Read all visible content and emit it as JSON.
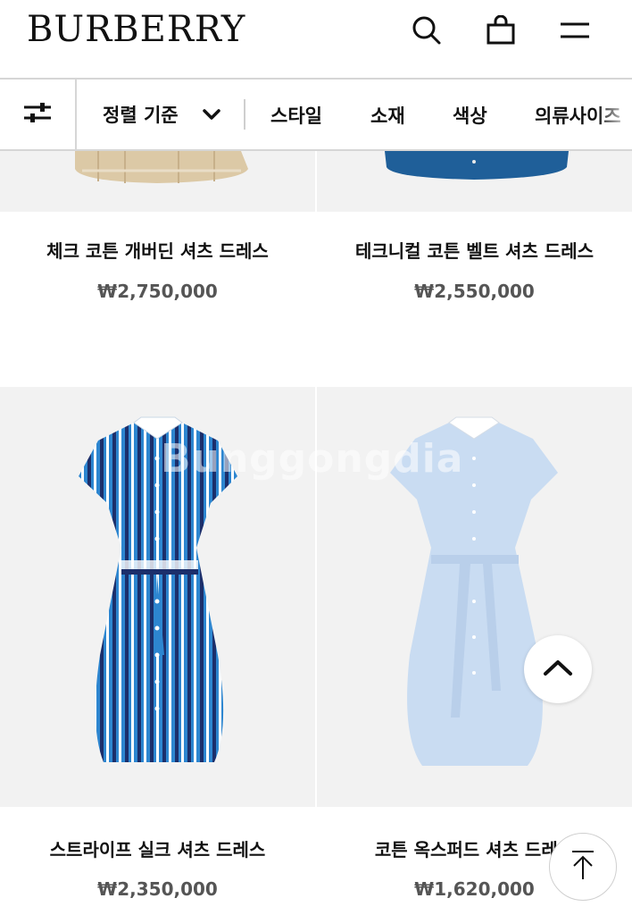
{
  "header": {
    "logo": "BURBERRY",
    "icons": [
      "search-icon",
      "shopping-bag-icon",
      "menu-icon"
    ]
  },
  "filterbar": {
    "filter_icon": "sliders-icon",
    "sort_label": "정렬 기준",
    "sort_icon": "chevron-down-icon",
    "items": [
      "스타일",
      "소재",
      "색상",
      "의류사이즈"
    ]
  },
  "products": [
    {
      "name": "체크 코튼 개버딘 셔츠 드레스",
      "price": "₩2,750,000"
    },
    {
      "name": "테크니컬 코튼 벨트 셔츠 드레스",
      "price": "₩2,550,000"
    },
    {
      "name": "스트라이프 실크 셔츠 드레스",
      "price": "₩2,350,000"
    },
    {
      "name": "코튼 옥스퍼드 셔츠 드레스",
      "price": "₩1,620,000"
    }
  ],
  "watermark": "Bunggongdia",
  "floating": {
    "scroll_up_icon": "chevron-up-icon",
    "back_to_top_icon": "arrow-up-to-top-icon"
  },
  "colors": {
    "beige": "#d9c6a4",
    "navy_blue": "#1e5a96",
    "stripe_blue": "#2a7fc8",
    "light_blue": "#c8dcf2"
  }
}
